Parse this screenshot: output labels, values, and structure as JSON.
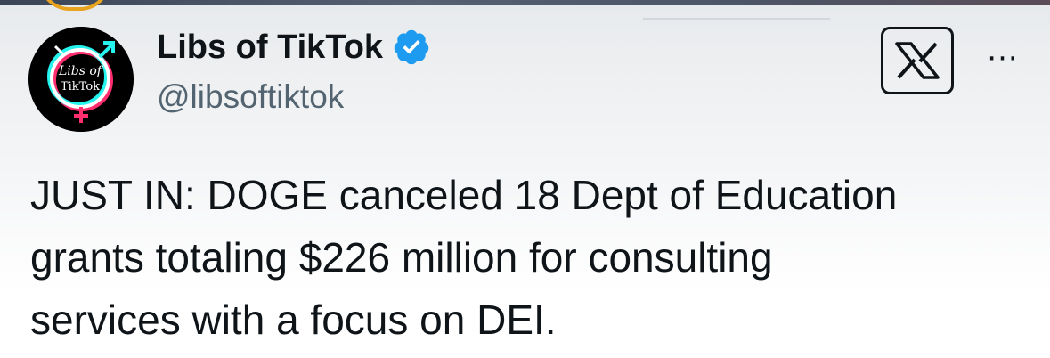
{
  "post": {
    "author": {
      "display_name": "Libs of TikTok",
      "handle": "@libsoftiktok",
      "verified": true,
      "verified_icon": "verified-badge-icon",
      "avatar_text": [
        "Libs of",
        "TikTok"
      ]
    },
    "text_lines": [
      "JUST IN: DOGE canceled 18 Dept of Education",
      "grants totaling $226 million for consulting",
      "services with a focus on DEI."
    ],
    "actions": {
      "brand_icon": "x-logo-icon",
      "more_label": "···"
    }
  },
  "colors": {
    "text": "#0f1419",
    "handle": "#536471",
    "verified_blue": "#1d9bf0",
    "top_accent": "#e8a21d"
  }
}
